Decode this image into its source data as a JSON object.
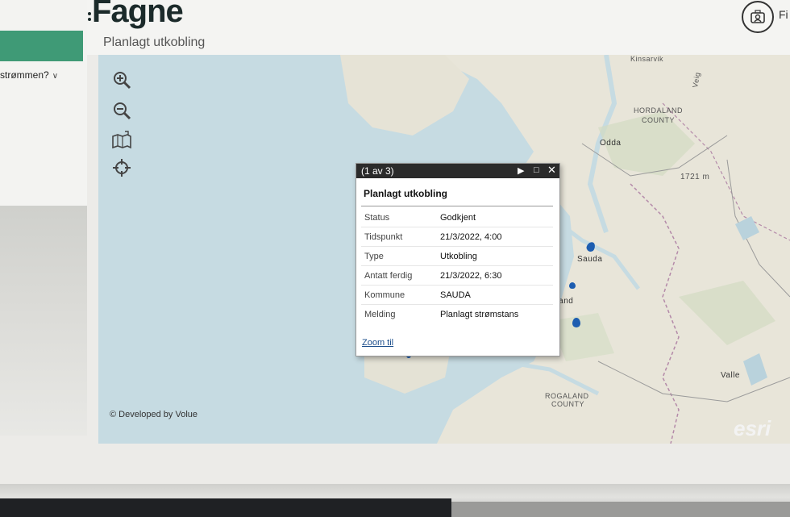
{
  "app": {
    "logo": "Fagne",
    "subtitle": "Planlagt utkobling",
    "user_label": "Fi"
  },
  "sidebar": {
    "dropdown_label": "strømmen?"
  },
  "map": {
    "credit": "© Developed by Volue",
    "esri_label": "esri",
    "places": {
      "kinsarvik": "Kinsarvik",
      "hordaland": "HORDALAND",
      "hordaland2": "COUNTY",
      "odda": "Odda",
      "elev": "1721 m",
      "sauda": "Sauda",
      "sand": "Sand",
      "rogaland": "ROGALAND",
      "rogaland2": "COUNTY",
      "valle": "Valle",
      "veg": "Veig"
    }
  },
  "popup": {
    "count": "(1 av 3)",
    "title": "Planlagt utkobling",
    "rows": [
      {
        "label": "Status",
        "value": "Godkjent"
      },
      {
        "label": "Tidspunkt",
        "value": "21/3/2022, 4:00"
      },
      {
        "label": "Type",
        "value": "Utkobling"
      },
      {
        "label": "Antatt ferdig",
        "value": "21/3/2022, 6:30"
      },
      {
        "label": "Kommune",
        "value": "SAUDA"
      },
      {
        "label": "Melding",
        "value": "Planlagt strømstans"
      }
    ],
    "zoom_link": "Zoom til"
  },
  "colors": {
    "accent_green": "#3f9a76",
    "marker_blue": "#1d5db0",
    "popup_header": "#2b2b2b"
  },
  "icons": [
    "zoom-in-icon",
    "zoom-out-icon",
    "map-layers-icon",
    "locate-icon",
    "user-icon"
  ]
}
